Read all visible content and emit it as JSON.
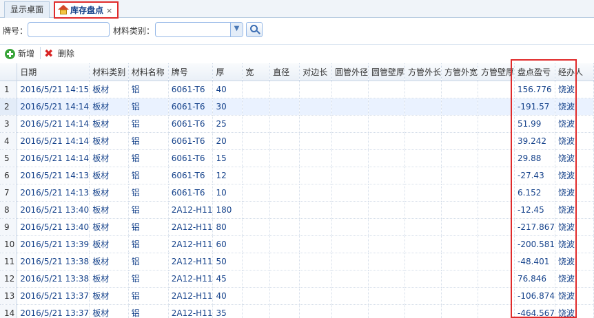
{
  "tabs": [
    {
      "label": "显示桌面",
      "active": false
    },
    {
      "label": "库存盘点",
      "active": true,
      "close": "×"
    }
  ],
  "search": {
    "brand_label": "牌号：",
    "brand_value": "",
    "category_label": "材料类别：",
    "category_value": ""
  },
  "toolbar": {
    "add_label": "新增",
    "delete_label": "删除"
  },
  "columns": [
    "",
    "日期",
    "材料类别",
    "材料名称",
    "牌号",
    "厚",
    "宽",
    "直径",
    "对边长",
    "圆管外径",
    "圆管壁厚",
    "方管外长",
    "方管外宽",
    "方管壁厚",
    "盘点盈亏",
    "经办人"
  ],
  "rows": [
    {
      "n": "1",
      "date": "2016/5/21 14:15",
      "cat": "板材",
      "name": "铝",
      "brand": "6061-T6",
      "thick": "40",
      "profit": "156.776",
      "op": "饶波"
    },
    {
      "n": "2",
      "date": "2016/5/21 14:14",
      "cat": "板材",
      "name": "铝",
      "brand": "6061-T6",
      "thick": "30",
      "profit": "-191.57",
      "op": "饶波"
    },
    {
      "n": "3",
      "date": "2016/5/21 14:14",
      "cat": "板材",
      "name": "铝",
      "brand": "6061-T6",
      "thick": "25",
      "profit": "51.99",
      "op": "饶波"
    },
    {
      "n": "4",
      "date": "2016/5/21 14:14",
      "cat": "板材",
      "name": "铝",
      "brand": "6061-T6",
      "thick": "20",
      "profit": "39.242",
      "op": "饶波"
    },
    {
      "n": "5",
      "date": "2016/5/21 14:14",
      "cat": "板材",
      "name": "铝",
      "brand": "6061-T6",
      "thick": "15",
      "profit": "29.88",
      "op": "饶波"
    },
    {
      "n": "6",
      "date": "2016/5/21 14:13",
      "cat": "板材",
      "name": "铝",
      "brand": "6061-T6",
      "thick": "12",
      "profit": "-27.43",
      "op": "饶波"
    },
    {
      "n": "7",
      "date": "2016/5/21 14:13",
      "cat": "板材",
      "name": "铝",
      "brand": "6061-T6",
      "thick": "10",
      "profit": "6.152",
      "op": "饶波"
    },
    {
      "n": "8",
      "date": "2016/5/21 13:40",
      "cat": "板材",
      "name": "铝",
      "brand": "2A12-H11",
      "thick": "180",
      "profit": "-12.45",
      "op": "饶波"
    },
    {
      "n": "9",
      "date": "2016/5/21 13:40",
      "cat": "板材",
      "name": "铝",
      "brand": "2A12-H11",
      "thick": "80",
      "profit": "-217.867",
      "op": "饶波"
    },
    {
      "n": "10",
      "date": "2016/5/21 13:39",
      "cat": "板材",
      "name": "铝",
      "brand": "2A12-H11",
      "thick": "60",
      "profit": "-200.581",
      "op": "饶波"
    },
    {
      "n": "11",
      "date": "2016/5/21 13:38",
      "cat": "板材",
      "name": "铝",
      "brand": "2A12-H11",
      "thick": "50",
      "profit": "-48.401",
      "op": "饶波"
    },
    {
      "n": "12",
      "date": "2016/5/21 13:38",
      "cat": "板材",
      "name": "铝",
      "brand": "2A12-H11",
      "thick": "45",
      "profit": "76.846",
      "op": "饶波"
    },
    {
      "n": "13",
      "date": "2016/5/21 13:37",
      "cat": "板材",
      "name": "铝",
      "brand": "2A12-H11",
      "thick": "40",
      "profit": "-106.874",
      "op": "饶波"
    },
    {
      "n": "14",
      "date": "2016/5/21 13:37",
      "cat": "板材",
      "name": "铝",
      "brand": "2A12-H11",
      "thick": "35",
      "profit": "-464.567",
      "op": "饶波"
    }
  ],
  "colors": {
    "highlight": "#e02a2a",
    "text": "#15428b"
  }
}
